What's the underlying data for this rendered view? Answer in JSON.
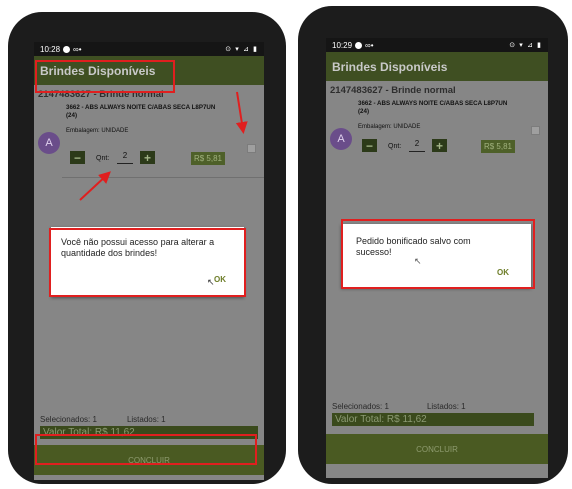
{
  "left_screen": {
    "status": {
      "time": "10:28",
      "icons": "⊙ ▾ ⊿ ▮"
    },
    "appbar": {
      "title": "Brindes Disponíveis"
    },
    "group_title": "2147483627 - Brinde normal",
    "item": {
      "avatar": "A",
      "name": "3662 - ABS ALWAYS NOITE C/ABAS SECA L8P7UN (24)",
      "embalagem": "Embalagem: UNIDADE",
      "minus": "−",
      "plus": "+",
      "qnt_label": "Qnt:",
      "qnt_value": "2",
      "price": "R$ 5,81"
    },
    "dialog": {
      "message": "Você não possui acesso para alterar a quantidade dos brindes!",
      "ok": "OK"
    },
    "footer": {
      "selecionados": "Selecionados: 1",
      "listados": "Listados: 1",
      "total": "Valor Total: R$ 11,62",
      "concluir": "CONCLUIR"
    }
  },
  "right_screen": {
    "status": {
      "time": "10:29",
      "icons": "⊙ ▾ ⊿ ▮"
    },
    "appbar": {
      "title": "Brindes Disponíveis"
    },
    "group_title": "2147483627 - Brinde normal",
    "item": {
      "avatar": "A",
      "name": "3662 - ABS ALWAYS NOITE C/ABAS SECA L8P7UN (24)",
      "embalagem": "Embalagem: UNIDADE",
      "minus": "−",
      "plus": "+",
      "qnt_label": "Qnt:",
      "qnt_value": "2",
      "price": "R$ 5,81"
    },
    "dialog": {
      "message": "Pedido bonificado salvo com sucesso!",
      "ok": "OK"
    },
    "footer": {
      "selecionados": "Selecionados: 1",
      "listados": "Listados: 1",
      "total": "Valor Total: R$ 11,62",
      "concluir": "CONCLUIR"
    }
  },
  "colors": {
    "appbar": "#3f4f22",
    "highlight": "#e01f1f",
    "ok_text": "#6d7d28"
  }
}
